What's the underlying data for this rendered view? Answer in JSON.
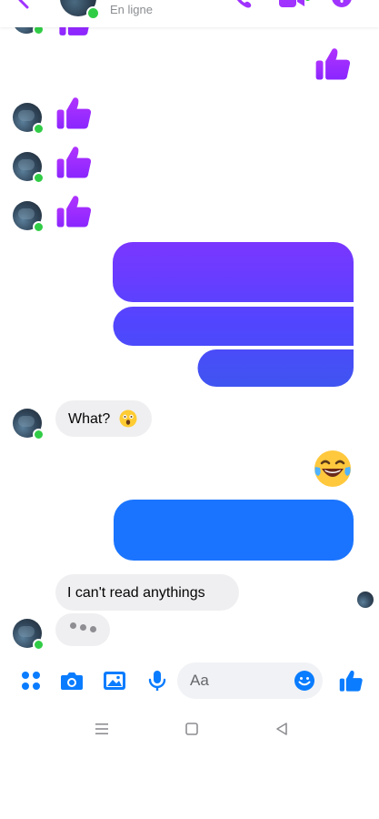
{
  "header": {
    "status_text": "En ligne",
    "accent_color": "#a033ff"
  },
  "messages": [
    {
      "direction": "outgoing",
      "type": "thumbs-up"
    },
    {
      "direction": "incoming",
      "type": "thumbs-up"
    },
    {
      "direction": "incoming",
      "type": "thumbs-up"
    },
    {
      "direction": "incoming",
      "type": "thumbs-up"
    },
    {
      "direction": "outgoing",
      "type": "blank-bubbles",
      "count": 3
    },
    {
      "direction": "incoming",
      "type": "text",
      "text": "What?",
      "emoji": "astonished-face"
    },
    {
      "direction": "outgoing",
      "type": "emoji",
      "emoji": "face-with-tears-of-joy"
    },
    {
      "direction": "outgoing",
      "type": "blank-bubble"
    },
    {
      "direction": "incoming",
      "type": "text",
      "text": "I can't read anythings"
    },
    {
      "direction": "incoming",
      "type": "typing-indicator"
    }
  ],
  "composer": {
    "placeholder": "Aa",
    "icons": [
      "apps-icon",
      "camera-icon",
      "image-icon",
      "microphone-icon",
      "smile-icon",
      "thumbs-up-icon"
    ],
    "icon_color": "#0a7cff"
  },
  "android_nav": [
    "recent-apps-icon",
    "home-icon",
    "back-icon"
  ],
  "colors": {
    "purple_gradient_top": "#a033ff",
    "purple_gradient_mid": "#5a48ff",
    "blue_bubble": "#0a7cff",
    "incoming_bubble": "#efeff1",
    "online": "#31cc46"
  }
}
